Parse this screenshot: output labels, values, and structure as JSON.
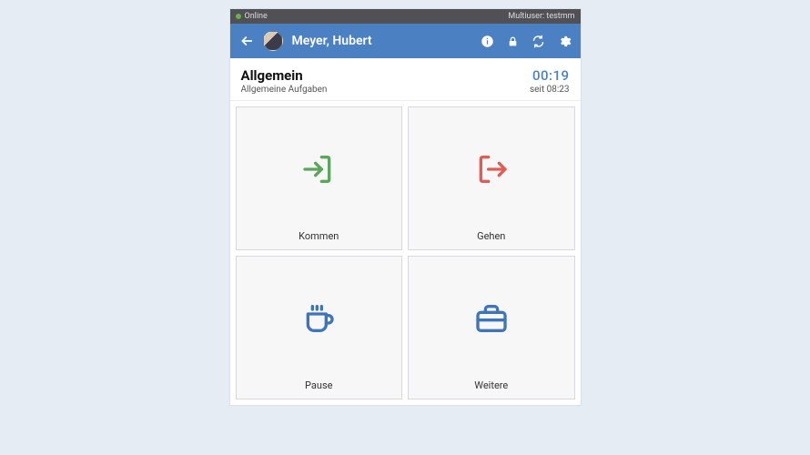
{
  "status": {
    "online_label": "Online",
    "multiuser_label": "Multiuser: testmm"
  },
  "header": {
    "user_name": "Meyer, Hubert"
  },
  "info": {
    "title": "Allgemein",
    "subtitle": "Allgemeine Aufgaben",
    "timer": "00:19",
    "since": "seit 08:23",
    "timer_color": "#4b81c2"
  },
  "tiles": [
    {
      "label": "Kommen",
      "icon": "login",
      "color": "#5aa65a"
    },
    {
      "label": "Gehen",
      "icon": "logout",
      "color": "#e25b55"
    },
    {
      "label": "Pause",
      "icon": "coffee",
      "color": "#3e74b8"
    },
    {
      "label": "Weitere",
      "icon": "briefcase",
      "color": "#3e74b8"
    }
  ]
}
